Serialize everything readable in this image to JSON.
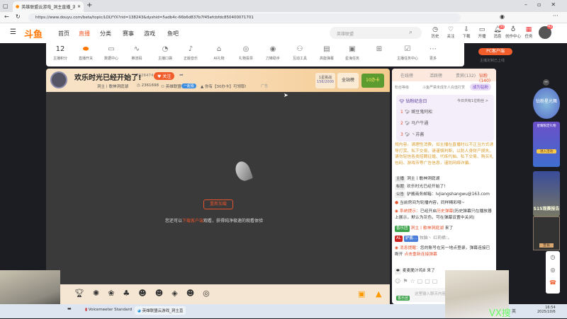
{
  "browser": {
    "tab_title": "英雄联盟云游戏_洞主直播_洞主",
    "url": "https://www.douyu.com/beta/topic/LOLYYX?rid=138243&dyshid=5adb4c-66b6d837b7f45efcbfdc850400071701"
  },
  "site": {
    "logo": "斗鱼",
    "nav": [
      "首页",
      "直播",
      "分类",
      "赛事",
      "游戏",
      "鱼吧"
    ],
    "search_placeholder": "英雄联盟",
    "header_icons": [
      {
        "label": "历史",
        "icon": "clock-icon"
      },
      {
        "label": "关注",
        "icon": "heart-icon"
      },
      {
        "label": "下载",
        "icon": "download-icon"
      },
      {
        "label": "开播",
        "icon": "camera-icon"
      },
      {
        "label": "消息",
        "icon": "bell-icon",
        "badge": "30"
      },
      {
        "label": "创作中心",
        "icon": "bulb-icon"
      },
      {
        "label": "任务",
        "icon": "gift-icon"
      }
    ],
    "avatar_badge": "42"
  },
  "toolbar": {
    "score": "12",
    "score_label": "主播积分",
    "items": [
      "直播开关",
      "数据中心",
      "推流码",
      "主播口袋",
      "正版音乐",
      "AI礼物",
      "礼物投票",
      "刀锋助手",
      "互动工具",
      "高能弹幕",
      "星海任务",
      "",
      "主播任务中心",
      "更多"
    ],
    "pc_client": "PC客户端",
    "pc_sub": "主播定制已上线"
  },
  "room": {
    "title": "欢乐时光已经开始了!",
    "room_id": "7026474",
    "follow": "关注",
    "streamer": "洞主丨歌神洞庭湖",
    "heat": "2361698",
    "category": "英雄联盟",
    "tag": "一起看",
    "promo": "你有【30办卡】可领取!",
    "ad": "广告",
    "challenge": "1星挑战",
    "challenge_progress": "156/2000",
    "rank_btn": "全站榜",
    "promo_badge": "10办卡"
  },
  "video": {
    "reload": "重新加载",
    "hint_pre": "您还可以",
    "hint_link": "下载客户端",
    "hint_post": "观看，获得纯净极速的观看体验"
  },
  "chat": {
    "tabs": [
      "在线榜",
      "活跃榜",
      "贵宾(132)",
      "钻粉(140)"
    ],
    "fan_level": "粉丝等级",
    "notice": "斗鱼严禁未成年人充值打赏",
    "become_fan": "成为钻粉",
    "fan_day": "钻粉纪念日",
    "fan_day_count": "今日共有1位粉丝 >",
    "fans": [
      {
        "rank": "1",
        "name": "豌豆鬼阿松"
      },
      {
        "rank": "2",
        "name": "马户牛通"
      },
      {
        "rank": "3",
        "name": "丶苏酱"
      }
    ],
    "warning": "规内容。请理性消费，如主播在直播时以不正当方式诱导打赏、私下交易，请谨慎判断，以防人身财产损失。请勿轻信各类招聘征婚、代练代抽、私下交易、购买礼包码、游戏币等广告信息，谨防网络诈骗。",
    "streamer_tag": "主播",
    "streamer_name": "洞主丨歌神洞庭湖",
    "title_tag": "标题",
    "title": "欢乐时光已经开始了!",
    "announce_tag": "公告",
    "announce": "驴酱商务邮箱：lvjiangshangwu@163.com",
    "rotation": "当前房间为轮播内容，同样精彩哦~",
    "sys_label": "系统提示：",
    "sys_pre": "已经开启",
    "sys_link": "历史弹幕",
    "sys_post": "(历史弹幕只在播放器上展示，默认为灰色，可在弹幕设置中关闭)",
    "enter_badge": "香乐团",
    "enter_name": "洞主丨歌神洞庭湖",
    "enter_suffix": "来了",
    "badge_al": "AL",
    "badge_fan": "驴酱...",
    "user_msg": "牧脑丶 红莉栖：。",
    "msg_label": "消息提醒：",
    "msg_text": "您的账号在另一地点登录，弹幕连接已断开",
    "msg_link": "点击重新连接弹幕",
    "last_user": "麦麦脆汁鸡8",
    "last_suffix": "来了",
    "input_placeholder": "这里输入聊天内容",
    "input_badge": "香乐团"
  },
  "side": {
    "banner1": "钻粉星光舞",
    "banner2": "星耀限定礼物",
    "banner2_btn": "进入活动",
    "banner3": "S15观赛报告",
    "banner4_btn": "查看"
  },
  "taskbar": {
    "apps": [
      "Voicemeeter Standard",
      "英雄联盟云游戏_洞主直"
    ],
    "time": "16:54",
    "date": "2025/10/6",
    "ime": "英"
  },
  "overlay": {
    "watermark": "VX搜"
  }
}
